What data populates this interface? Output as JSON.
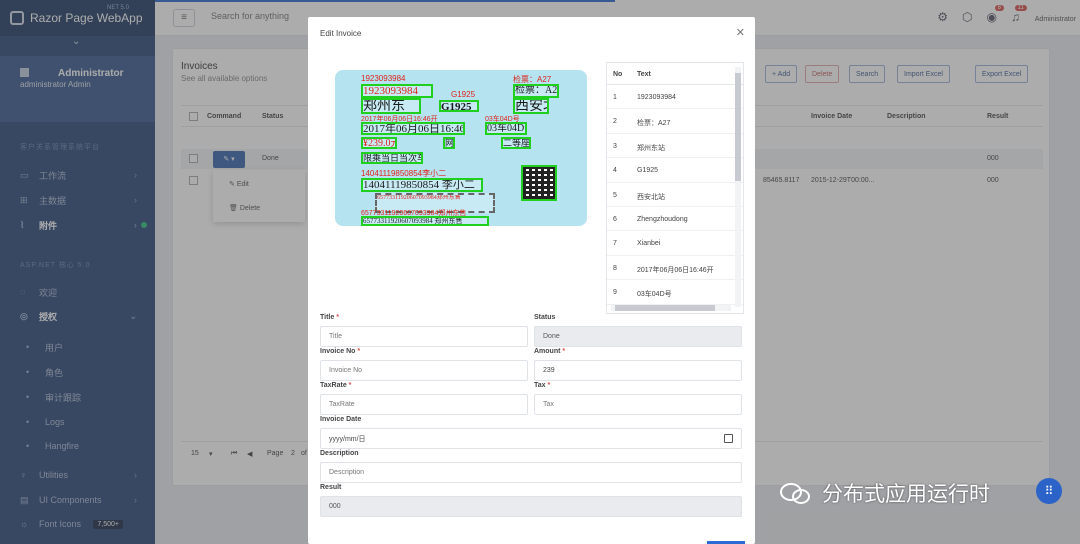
{
  "app": {
    "brand": "Razor Page WebApp",
    "version": "NET 5.0"
  },
  "topbar": {
    "search_placeholder": "Search for anything",
    "admin_label": "Administrator",
    "badge_1": "6",
    "badge_2": "11"
  },
  "sidebar": {
    "user_name": "Administrator",
    "user_login": "administrator",
    "user_login_extra": "Admin",
    "section_1": "客户关系管理系统平台",
    "items_1": [
      {
        "label": "工作流",
        "icon": "workflow-icon"
      },
      {
        "label": "主数据",
        "icon": "database-icon"
      },
      {
        "label": "附件",
        "icon": "paperclip-icon"
      }
    ],
    "section_2": "ASP.NET 核心 5.0",
    "items_2": [
      {
        "label": "欢迎",
        "icon": "welcome-icon"
      },
      {
        "label": "授权",
        "icon": "lock-icon"
      }
    ],
    "sub_items": [
      "用户",
      "角色",
      "审计跟踪",
      "Logs",
      "Hangfire"
    ],
    "items_3": [
      {
        "label": "Utilities",
        "icon": "utilities-icon"
      },
      {
        "label": "UI Components",
        "icon": "components-icon"
      },
      {
        "label": "Font Icons",
        "icon": "font-icon",
        "badge": "7,500+"
      }
    ]
  },
  "page": {
    "title": "Invoices",
    "subtitle": "See all available options",
    "toolbar": {
      "add": "+ Add",
      "delete": "Delete",
      "search": "Search",
      "import": "Import Excel",
      "export": "Export Excel"
    },
    "columns": {
      "command": "Command",
      "status": "Status",
      "invoice_date": "Invoice Date",
      "description": "Description",
      "result": "Result"
    },
    "rows": [
      {
        "status": "Done",
        "amount": "",
        "date": "",
        "result": "000"
      },
      {
        "status": "",
        "amount": "85465.8117",
        "date": "2015-12-29T00:00...",
        "result": "000"
      }
    ],
    "context_menu": {
      "edit": "Edit",
      "delete": "Delete"
    },
    "pager": {
      "page_size": "15",
      "page_label": "Page",
      "page": "2",
      "of": "of"
    }
  },
  "modal": {
    "title": "Edit Invoice",
    "ticket": {
      "serial": "1923093984",
      "gate": "检票：A27",
      "train": "G1925",
      "from": "郑州东",
      "to": "西安北",
      "from_pinyin": "Zhengzhoudong",
      "to_pinyin": "Xianbei",
      "datetime": "2017年06月06日16:46开",
      "car": "03车04D号",
      "price": "¥239.0元",
      "class": "二等座",
      "seat": "网",
      "note": "限乘当日当次车",
      "id": "14041119850854李小二",
      "id_box": "14041119850854 李小二",
      "code": "65773311920607093984郑州东售",
      "code_box": "65773311920607093984 郑州东售"
    },
    "ocr": {
      "col_no": "No",
      "col_text": "Text",
      "rows": [
        {
          "no": "1",
          "text": "1923093984"
        },
        {
          "no": "2",
          "text": "检票：A27"
        },
        {
          "no": "3",
          "text": "郑州东站"
        },
        {
          "no": "4",
          "text": "G1925"
        },
        {
          "no": "5",
          "text": "西安北站"
        },
        {
          "no": "6",
          "text": "Zhengzhoudong"
        },
        {
          "no": "7",
          "text": "Xianbei"
        },
        {
          "no": "8",
          "text": "2017年06月06日16:46开"
        },
        {
          "no": "9",
          "text": "03车04D号"
        }
      ]
    },
    "form": {
      "title_label": "Title",
      "title_placeholder": "Title",
      "status_label": "Status",
      "status_value": "Done",
      "invoice_no_label": "Invoice No",
      "invoice_no_placeholder": "Invoice No",
      "amount_label": "Amount",
      "amount_value": "239",
      "taxrate_label": "TaxRate",
      "taxrate_placeholder": "TaxRate",
      "tax_label": "Tax",
      "tax_placeholder": "Tax",
      "invoice_date_label": "Invoice Date",
      "invoice_date_placeholder": "yyyy/mm/日",
      "description_label": "Description",
      "description_placeholder": "Description",
      "result_label": "Result",
      "result_value": "000",
      "required_mark": "*"
    }
  },
  "watermark": {
    "text": "分布式应用运行时"
  },
  "colors": {
    "sidebar": "#2c4a7a",
    "primary": "#3a67b0",
    "ocr_box": "#1fd01f",
    "ocr_text": "#e0231a"
  }
}
